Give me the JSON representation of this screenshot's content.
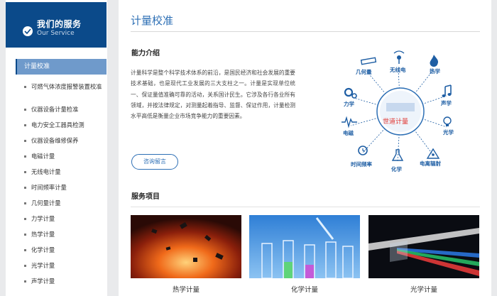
{
  "sidebar": {
    "header_title": "我们的服务",
    "header_subtitle": "Our Service",
    "active_item": "计量校准",
    "items": [
      "可燃气体浓度报警装置校准",
      "仪器设备计量检准",
      "电力安全工器具检测",
      "仪器设备维修保养",
      "电磁计量",
      "无线电计量",
      "时间频率计量",
      "几何量计量",
      "力学计量",
      "热学计量",
      "化学计量",
      "光学计量",
      "声学计量"
    ]
  },
  "main": {
    "page_title": "计量校准",
    "capability_heading": "能力介绍",
    "intro_text": "计量科学是整个科学技术体系的前沿，是国民经济和社会发展的重要技术基础，也是现代工业发展的三大支柱之一。计量是实现单位统一、保证量值准确可靠的活动，关系国计民生。它涉及各行各业所有领域，并按法律规定，对测量起着指导、监督、保证作用，计量检测水平高低是衡量企业市场竞争能力的重要因素。",
    "consult_button": "咨询留言",
    "services_heading": "服务项目"
  },
  "diagram": {
    "center_label": "世道计量",
    "labels": {
      "geometry": "几何量",
      "radio": "无线电",
      "thermal": "热学",
      "mechanics": "力学",
      "acoustic": "声学",
      "electromagnetic": "电磁",
      "optical": "光学",
      "time": "时间频率",
      "chemistry": "化学",
      "radiation": "电离辐射"
    },
    "accent_color": "#1e5ea4"
  },
  "cards": [
    {
      "caption": "热学计量"
    },
    {
      "caption": "化学计量"
    },
    {
      "caption": "光学计量"
    }
  ],
  "colors": {
    "brand_blue": "#0b4a8a",
    "active_menu": "#6f9acb",
    "title_blue": "#2d6fb5"
  }
}
